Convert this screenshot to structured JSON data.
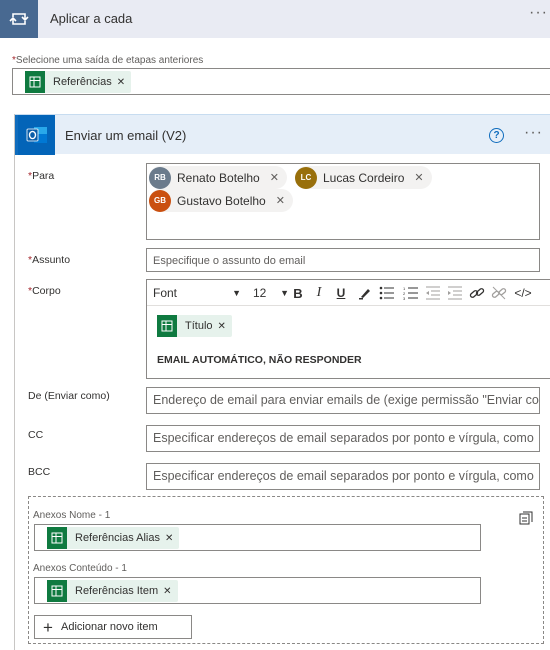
{
  "apply_each": {
    "title": "Aplicar a cada",
    "more": "···"
  },
  "select_output": {
    "label": "Selecione uma saída de etapas anteriores",
    "token": "Referências"
  },
  "email_action": {
    "title": "Enviar um email (V2)",
    "help": "?",
    "more": "···",
    "to": {
      "label": "Para",
      "recipients": [
        {
          "initials": "RB",
          "name": "Renato Botelho",
          "color": "#6b7b8c"
        },
        {
          "initials": "LC",
          "name": "Lucas Cordeiro",
          "color": "#986f0b"
        },
        {
          "initials": "GB",
          "name": "Gustavo Botelho",
          "color": "#ca5010"
        }
      ]
    },
    "subject": {
      "label": "Assunto",
      "placeholder": "Especifique o assunto do email"
    },
    "body": {
      "label": "Corpo",
      "font": "Font",
      "size": "12",
      "token": "Título",
      "text": "EMAIL AUTOMÁTICO, NÃO RESPONDER"
    },
    "from": {
      "label": "De (Enviar como)",
      "placeholder": "Endereço de email para enviar emails de (exige permissão \"Enviar como\")"
    },
    "cc": {
      "label": "CC",
      "placeholder": "Especificar endereços de email separados por ponto e vírgula, como"
    },
    "bcc": {
      "label": "BCC",
      "placeholder": "Especificar endereços de email separados por ponto e vírgula, como"
    },
    "attachments": {
      "name_label": "Anexos Nome - 1",
      "name_token": "Referências Alias",
      "content_label": "Anexos Conteúdo - 1",
      "content_token": "Referências Item",
      "add_label": "Adicionar novo item"
    }
  },
  "colors": {
    "loop_blue": "#486991",
    "outlook_blue": "#0364b8",
    "token_green": "#0f7a40",
    "token_bg": "#e6f2ec",
    "required": "#a4262c"
  }
}
